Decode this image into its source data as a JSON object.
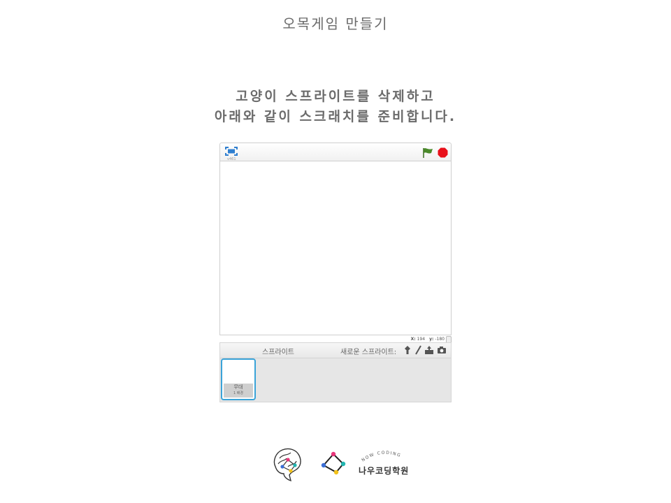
{
  "slide": {
    "title": "오목게임 만들기",
    "instruction_line1": "고양이 스프라이트를 삭제하고",
    "instruction_line2": "아래와 같이 스크래치를 준비합니다."
  },
  "stage": {
    "version": "v461",
    "coord_x_label": "X:",
    "coord_x_value": "194",
    "coord_y_label": "y:",
    "coord_y_value": "-180",
    "flag_color": "#4a8a2a",
    "stop_color": "#e8101a"
  },
  "sprite_pane": {
    "sprites_label": "스프라이트",
    "new_sprite_label": "새로운 스프라이트:",
    "stage_thumb_label": "무대",
    "stage_thumb_sub": "1 배경",
    "tools": [
      "paint-from-library-icon",
      "paint-brush-icon",
      "upload-sprite-icon",
      "camera-icon"
    ]
  },
  "brand": {
    "arc_text": "NOW CODING",
    "name": "나우코딩학원"
  }
}
